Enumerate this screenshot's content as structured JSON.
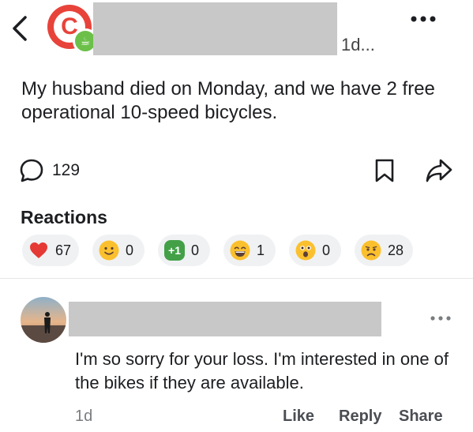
{
  "post": {
    "time": "1d...",
    "text": "My husband died on Monday, and we have 2 free operational 10-speed bicycles.",
    "comment_count": "129",
    "author_initial": "C",
    "author_badge_icon": "mug-icon"
  },
  "reactions": {
    "title": "Reactions",
    "items": [
      {
        "name": "heart",
        "count": "67"
      },
      {
        "name": "smile",
        "count": "0"
      },
      {
        "name": "plus-one",
        "label": "+1",
        "count": "0"
      },
      {
        "name": "grin",
        "count": "1"
      },
      {
        "name": "surprised",
        "count": "0"
      },
      {
        "name": "sad",
        "count": "28"
      }
    ]
  },
  "comment": {
    "text": "I'm so sorry for your loss. I'm interested in one of the bikes if they are available.",
    "time": "1d",
    "actions": {
      "like": "Like",
      "reply": "Reply",
      "share": "Share"
    }
  },
  "colors": {
    "accent_red": "#e8433a",
    "badge_green": "#6cc04a",
    "text": "#1c1e21",
    "muted": "#7a7d80"
  }
}
